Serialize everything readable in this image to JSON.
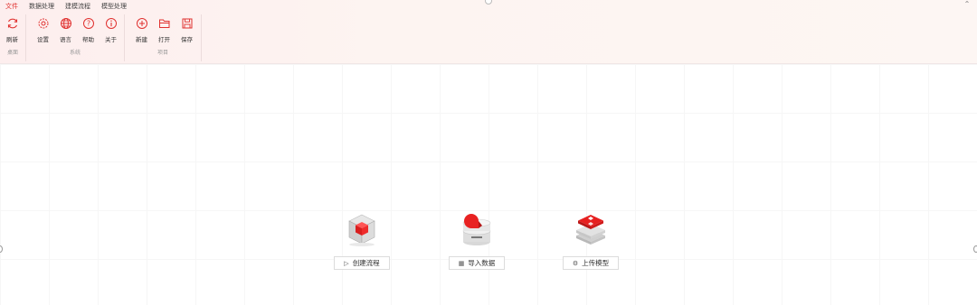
{
  "menu": {
    "tabs": [
      "文件",
      "数据处理",
      "建模流程",
      "模型处理"
    ],
    "active_tab": 0
  },
  "ribbon": {
    "groups": [
      {
        "label": "桌面",
        "items": [
          {
            "label": "刷新",
            "icon": "refresh-icon"
          }
        ]
      },
      {
        "label": "系统",
        "items": [
          {
            "label": "设置",
            "icon": "gear-icon"
          },
          {
            "label": "语言",
            "icon": "globe-icon"
          },
          {
            "label": "帮助",
            "icon": "help-icon"
          },
          {
            "label": "关于",
            "icon": "info-icon"
          }
        ]
      },
      {
        "label": "项目",
        "items": [
          {
            "label": "新建",
            "icon": "plus-circle-icon"
          },
          {
            "label": "打开",
            "icon": "folder-open-icon"
          },
          {
            "label": "保存",
            "icon": "save-icon"
          }
        ]
      }
    ]
  },
  "actions": {
    "create_flow": {
      "label": "创建流程",
      "icon": "play-icon"
    },
    "import_data": {
      "label": "导入数据",
      "icon": "table-icon"
    },
    "upload_model": {
      "label": "上传模型",
      "icon": "settings-circle-icon"
    }
  },
  "colors": {
    "accent": "#e0312f",
    "ribbon_bg": "#fdf0ee"
  }
}
